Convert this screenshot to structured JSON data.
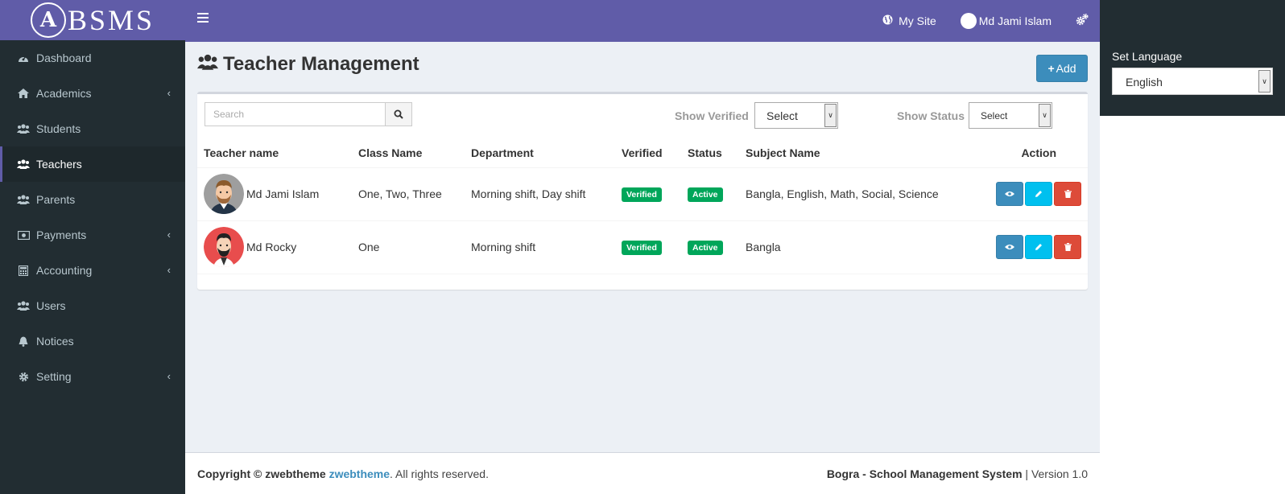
{
  "brand": {
    "emblem_letter": "A",
    "name": "BSMS"
  },
  "sidebar": {
    "items": [
      {
        "label": "Dashboard",
        "icon": "dashboard-icon",
        "has_caret": false,
        "active": false
      },
      {
        "label": "Academics",
        "icon": "home-icon",
        "has_caret": true,
        "active": false
      },
      {
        "label": "Students",
        "icon": "users-icon",
        "has_caret": false,
        "active": false
      },
      {
        "label": "Teachers",
        "icon": "users-icon",
        "has_caret": false,
        "active": true
      },
      {
        "label": "Parents",
        "icon": "users-icon",
        "has_caret": false,
        "active": false
      },
      {
        "label": "Payments",
        "icon": "money-icon",
        "has_caret": true,
        "active": false
      },
      {
        "label": "Accounting",
        "icon": "calculator-icon",
        "has_caret": true,
        "active": false
      },
      {
        "label": "Users",
        "icon": "users-icon",
        "has_caret": false,
        "active": false
      },
      {
        "label": "Notices",
        "icon": "bell-icon",
        "has_caret": false,
        "active": false
      },
      {
        "label": "Setting",
        "icon": "gear-icon",
        "has_caret": true,
        "active": false
      }
    ],
    "caret": "‹"
  },
  "header": {
    "my_site": "My Site",
    "user_name": "Md Jami Islam"
  },
  "language_panel": {
    "title": "Set Language",
    "selected": "English"
  },
  "page": {
    "title": "Teacher Management",
    "add_label": "Add"
  },
  "filters": {
    "search_placeholder": "Search",
    "verified_label": "Show Verified",
    "verified_value": "Select",
    "status_label": "Show Status",
    "status_value": "Select"
  },
  "table": {
    "headers": [
      "Teacher name",
      "Class Name",
      "Department",
      "Verified",
      "Status",
      "Subject Name",
      "Action"
    ],
    "rows": [
      {
        "name": "Md Jami Islam",
        "classes": "One, Two, Three",
        "department": "Morning shift, Day shift",
        "verified": "Verified",
        "status": "Active",
        "subjects": "Bangla, English, Math, Social, Science"
      },
      {
        "name": "Md Rocky",
        "classes": "One",
        "department": "Morning shift",
        "verified": "Verified",
        "status": "Active",
        "subjects": "Bangla"
      }
    ]
  },
  "footer": {
    "copyright": "Copyright © zwebtheme",
    "link": "zwebtheme",
    "rights": ". All rights reserved.",
    "app_name": "Bogra - School Management System",
    "version": "| Version 1.0"
  },
  "colors": {
    "header": "#605ca8",
    "sidebar": "#222d32",
    "primary": "#3c8dbc",
    "info": "#00c0ef",
    "danger": "#dd4b39",
    "success": "#00a65a"
  }
}
